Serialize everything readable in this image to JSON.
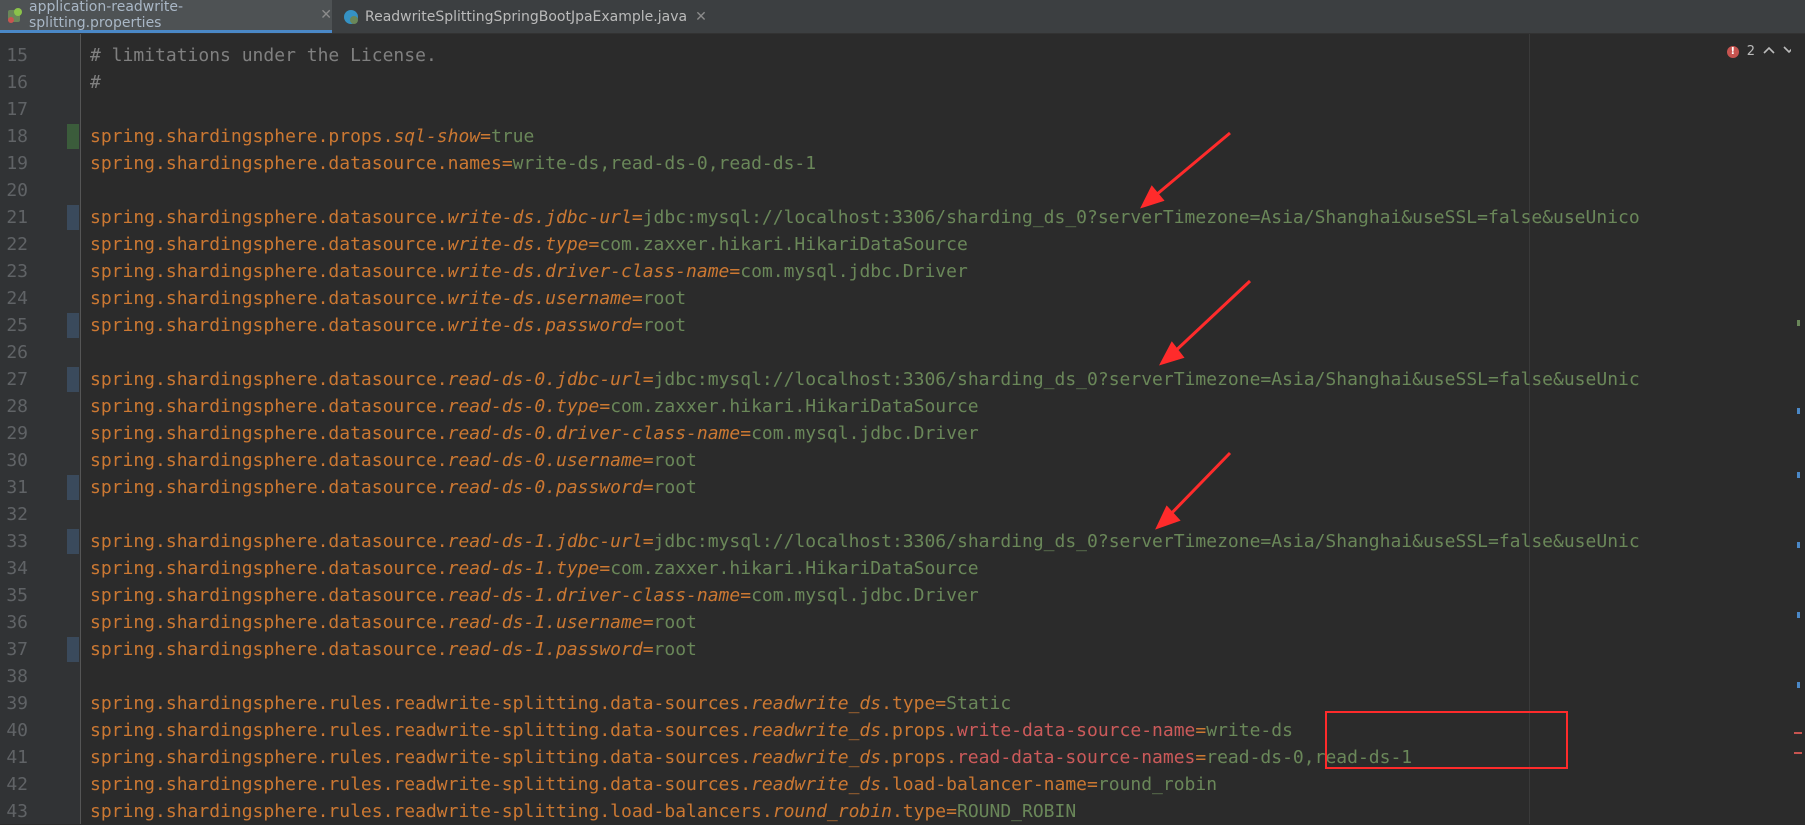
{
  "tabs": [
    {
      "label": "application-readwrite-splitting.properties",
      "active": true
    },
    {
      "label": "ReadwriteSplittingSpringBootJpaExample.java",
      "active": false
    }
  ],
  "close_glyph": "✕",
  "error_count": "2",
  "lines": [
    {
      "n": "15",
      "parts": [
        [
          "comment",
          "# limitations under the License."
        ]
      ]
    },
    {
      "n": "16",
      "parts": [
        [
          "comment",
          "#"
        ]
      ]
    },
    {
      "n": "17",
      "parts": []
    },
    {
      "n": "18",
      "parts": [
        [
          "key",
          "spring.shardingsphere.props."
        ],
        [
          "ital",
          "sql-show"
        ],
        [
          "eq",
          "="
        ],
        [
          "val",
          "true"
        ]
      ],
      "mark": "#3b5c3b"
    },
    {
      "n": "19",
      "parts": [
        [
          "key",
          "spring.shardingsphere.datasource.names"
        ],
        [
          "eq",
          "="
        ],
        [
          "val",
          "write-ds,read-ds-0,read-ds-1"
        ]
      ]
    },
    {
      "n": "20",
      "parts": []
    },
    {
      "n": "21",
      "parts": [
        [
          "key",
          "spring.shardingsphere.datasource."
        ],
        [
          "ital",
          "write-ds.jdbc-url"
        ],
        [
          "eq",
          "="
        ],
        [
          "val",
          "jdbc:mysql://localhost:3306/sharding_ds_0?serverTimezone=Asia/Shanghai&useSSL=false&useUnico"
        ]
      ],
      "mark": "#3a4a5c"
    },
    {
      "n": "22",
      "parts": [
        [
          "key",
          "spring.shardingsphere.datasource."
        ],
        [
          "ital",
          "write-ds.type"
        ],
        [
          "eq",
          "="
        ],
        [
          "val",
          "com.zaxxer.hikari.HikariDataSource"
        ]
      ]
    },
    {
      "n": "23",
      "parts": [
        [
          "key",
          "spring.shardingsphere.datasource."
        ],
        [
          "ital",
          "write-ds.driver-class-name"
        ],
        [
          "eq",
          "="
        ],
        [
          "val",
          "com.mysql.jdbc.Driver"
        ]
      ]
    },
    {
      "n": "24",
      "parts": [
        [
          "key",
          "spring.shardingsphere.datasource."
        ],
        [
          "ital",
          "write-ds.username"
        ],
        [
          "eq",
          "="
        ],
        [
          "val",
          "root"
        ]
      ]
    },
    {
      "n": "25",
      "parts": [
        [
          "key",
          "spring.shardingsphere.datasource."
        ],
        [
          "ital",
          "write-ds.password"
        ],
        [
          "eq",
          "="
        ],
        [
          "val",
          "root"
        ]
      ],
      "mark": "#3a4a5c"
    },
    {
      "n": "26",
      "parts": []
    },
    {
      "n": "27",
      "parts": [
        [
          "key",
          "spring.shardingsphere.datasource."
        ],
        [
          "ital",
          "read-ds-0.jdbc-url"
        ],
        [
          "eq",
          "="
        ],
        [
          "val",
          "jdbc:mysql://localhost:3306/sharding_ds_0?serverTimezone=Asia/Shanghai&useSSL=false&useUnic"
        ]
      ],
      "mark": "#3a4a5c"
    },
    {
      "n": "28",
      "parts": [
        [
          "key",
          "spring.shardingsphere.datasource."
        ],
        [
          "ital",
          "read-ds-0.type"
        ],
        [
          "eq",
          "="
        ],
        [
          "val",
          "com.zaxxer.hikari.HikariDataSource"
        ]
      ]
    },
    {
      "n": "29",
      "parts": [
        [
          "key",
          "spring.shardingsphere.datasource."
        ],
        [
          "ital",
          "read-ds-0.driver-class-name"
        ],
        [
          "eq",
          "="
        ],
        [
          "val",
          "com.mysql.jdbc.Driver"
        ]
      ]
    },
    {
      "n": "30",
      "parts": [
        [
          "key",
          "spring.shardingsphere.datasource."
        ],
        [
          "ital",
          "read-ds-0.username"
        ],
        [
          "eq",
          "="
        ],
        [
          "val",
          "root"
        ]
      ]
    },
    {
      "n": "31",
      "parts": [
        [
          "key",
          "spring.shardingsphere.datasource."
        ],
        [
          "ital",
          "read-ds-0.password"
        ],
        [
          "eq",
          "="
        ],
        [
          "val",
          "root"
        ]
      ],
      "mark": "#3a4a5c"
    },
    {
      "n": "32",
      "parts": []
    },
    {
      "n": "33",
      "parts": [
        [
          "key",
          "spring.shardingsphere.datasource."
        ],
        [
          "ital",
          "read-ds-1.jdbc-url"
        ],
        [
          "eq",
          "="
        ],
        [
          "val",
          "jdbc:mysql://localhost:3306/sharding_ds_0?serverTimezone=Asia/Shanghai&useSSL=false&useUnic"
        ]
      ],
      "mark": "#3a4a5c"
    },
    {
      "n": "34",
      "parts": [
        [
          "key",
          "spring.shardingsphere.datasource."
        ],
        [
          "ital",
          "read-ds-1.type"
        ],
        [
          "eq",
          "="
        ],
        [
          "val",
          "com.zaxxer.hikari.HikariDataSource"
        ]
      ]
    },
    {
      "n": "35",
      "parts": [
        [
          "key",
          "spring.shardingsphere.datasource."
        ],
        [
          "ital",
          "read-ds-1.driver-class-name"
        ],
        [
          "eq",
          "="
        ],
        [
          "val",
          "com.mysql.jdbc.Driver"
        ]
      ]
    },
    {
      "n": "36",
      "parts": [
        [
          "key",
          "spring.shardingsphere.datasource."
        ],
        [
          "ital",
          "read-ds-1.username"
        ],
        [
          "eq",
          "="
        ],
        [
          "val",
          "root"
        ]
      ]
    },
    {
      "n": "37",
      "parts": [
        [
          "key",
          "spring.shardingsphere.datasource."
        ],
        [
          "ital",
          "read-ds-1.password"
        ],
        [
          "eq",
          "="
        ],
        [
          "val",
          "root"
        ]
      ],
      "mark": "#3a4a5c"
    },
    {
      "n": "38",
      "parts": []
    },
    {
      "n": "39",
      "parts": [
        [
          "key",
          "spring.shardingsphere.rules.readwrite-splitting.data-sources."
        ],
        [
          "ital",
          "readwrite_ds"
        ],
        [
          "key",
          ".type"
        ],
        [
          "eq",
          "="
        ],
        [
          "val",
          "Static"
        ]
      ]
    },
    {
      "n": "40",
      "parts": [
        [
          "key",
          "spring.shardingsphere.rules.readwrite-splitting.data-sources."
        ],
        [
          "ital",
          "readwrite_ds"
        ],
        [
          "key",
          ".props."
        ],
        [
          "red",
          "write-data-source-name"
        ],
        [
          "eq",
          "="
        ],
        [
          "val",
          "write-ds"
        ]
      ]
    },
    {
      "n": "41",
      "parts": [
        [
          "key",
          "spring.shardingsphere.rules.readwrite-splitting.data-sources."
        ],
        [
          "ital",
          "readwrite_ds"
        ],
        [
          "key",
          ".props."
        ],
        [
          "red",
          "read-data-source-names"
        ],
        [
          "eq",
          "="
        ],
        [
          "val",
          "read-ds-0,read-ds-1"
        ]
      ]
    },
    {
      "n": "42",
      "parts": [
        [
          "key",
          "spring.shardingsphere.rules.readwrite-splitting.data-sources."
        ],
        [
          "ital",
          "readwrite_ds"
        ],
        [
          "key",
          ".load-balancer-name"
        ],
        [
          "eq",
          "="
        ],
        [
          "val",
          "round_robin"
        ]
      ]
    },
    {
      "n": "43",
      "parts": [
        [
          "key",
          "spring.shardingsphere.rules.readwrite-splitting.load-balancers."
        ],
        [
          "ital",
          "round_robin"
        ],
        [
          "key",
          ".type"
        ],
        [
          "eq",
          "="
        ],
        [
          "val",
          "ROUND_ROBIN"
        ]
      ]
    }
  ],
  "colors": {
    "accent": "#4a88c7",
    "annotation": "#ff2b2b",
    "error": "#c75450"
  },
  "icons": [
    "spring-properties-icon",
    "java-class-icon",
    "error-icon",
    "arrow-up-icon",
    "arrow-down-icon"
  ]
}
